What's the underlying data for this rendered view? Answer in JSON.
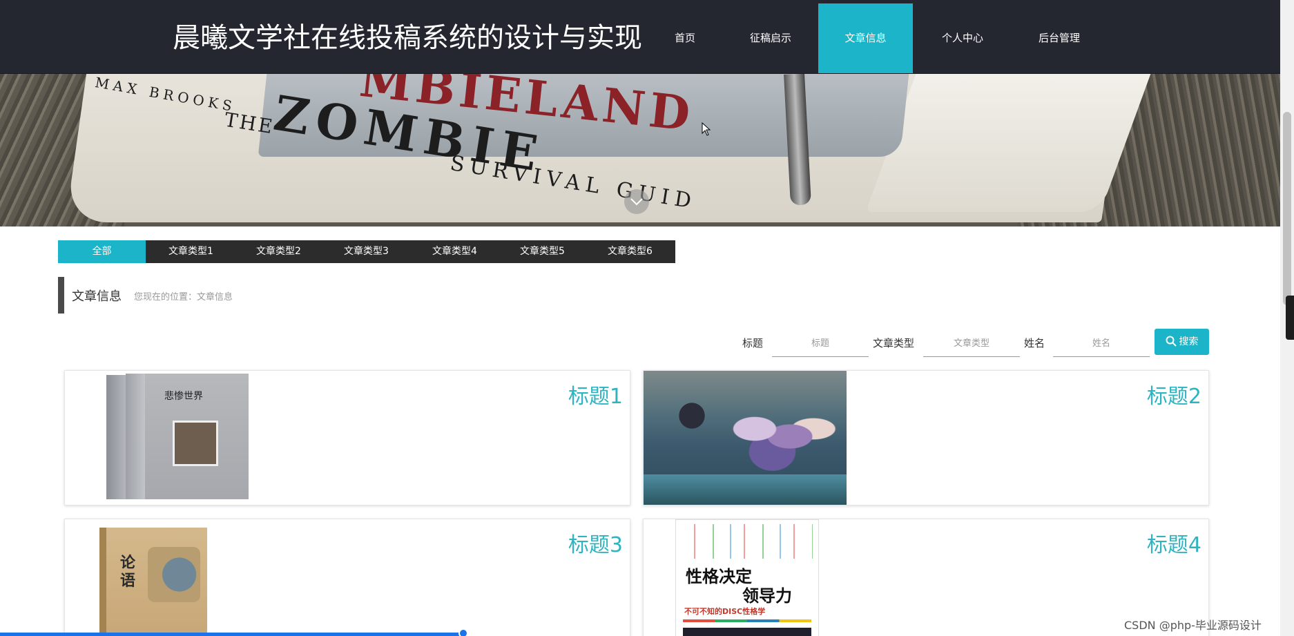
{
  "header": {
    "site_title": "晨曦文学社在线投稿系统的设计与实现",
    "nav": [
      {
        "label": "首页",
        "active": false
      },
      {
        "label": "征稿启示",
        "active": false
      },
      {
        "label": "文章信息",
        "active": true
      },
      {
        "label": "个人中心",
        "active": false
      },
      {
        "label": "后台管理",
        "active": false
      }
    ]
  },
  "banner": {
    "cover_author": "MAX BROOKS",
    "cover_the": "THE",
    "cover_zombie": "ZOMBIE",
    "cover_survival": "SURVIVAL GUID",
    "cover_land": "MBIELAND"
  },
  "categories": [
    {
      "label": "全部",
      "active": true
    },
    {
      "label": "文章类型1",
      "active": false
    },
    {
      "label": "文章类型2",
      "active": false
    },
    {
      "label": "文章类型3",
      "active": false
    },
    {
      "label": "文章类型4",
      "active": false
    },
    {
      "label": "文章类型5",
      "active": false
    },
    {
      "label": "文章类型6",
      "active": false
    }
  ],
  "section": {
    "title": "文章信息",
    "breadcrumb": "您现在的位置：文章信息"
  },
  "search": {
    "title_label": "标题",
    "title_placeholder": "标题",
    "type_label": "文章类型",
    "type_placeholder": "文章类型",
    "name_label": "姓名",
    "name_placeholder": "姓名",
    "button_label": "搜索"
  },
  "articles": [
    {
      "title": "标题1",
      "cover_text": "悲惨世界"
    },
    {
      "title": "标题2"
    },
    {
      "title": "标题3",
      "cover_text": "论语"
    },
    {
      "title": "标题4",
      "cover_line1": "性格决定",
      "cover_line2": "领导力",
      "cover_line3": "不可不知的DISC性格学"
    }
  ],
  "watermark": "CSDN @php-毕业源码设计",
  "colors": {
    "header_bg": "#242630",
    "accent": "#1bb4c8",
    "card_title": "#2fb3c1",
    "category_bar": "#2c2c2c"
  }
}
